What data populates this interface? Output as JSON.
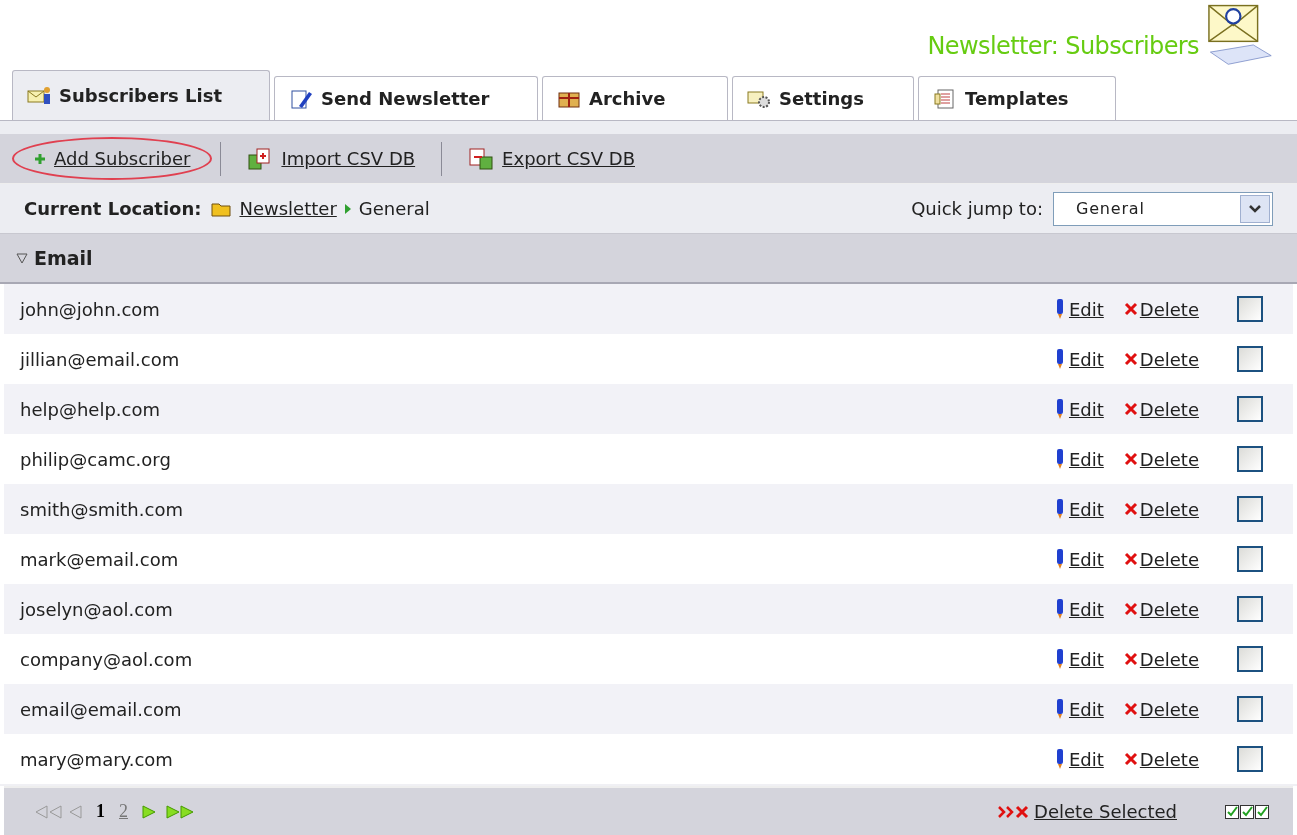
{
  "title": "Newsletter: Subscribers",
  "tabs": [
    {
      "label": "Subscribers List",
      "kind": "subscribers",
      "selected": true
    },
    {
      "label": "Send Newsletter",
      "kind": "send",
      "selected": false
    },
    {
      "label": "Archive",
      "kind": "archive",
      "selected": false
    },
    {
      "label": "Settings",
      "kind": "settings",
      "selected": false
    },
    {
      "label": "Templates",
      "kind": "templates",
      "selected": false
    }
  ],
  "toolbar": [
    {
      "label": "Add Subscriber",
      "kind": "add",
      "highlighted": true
    },
    {
      "label": "Import CSV DB",
      "kind": "import",
      "highlighted": false
    },
    {
      "label": "Export CSV DB",
      "kind": "export",
      "highlighted": false
    }
  ],
  "location": {
    "label": "Current Location:",
    "path": [
      "Newsletter",
      "General"
    ],
    "quick_jump_label": "Quick jump to:",
    "quick_jump_value": "General"
  },
  "table": {
    "column": "Email",
    "rows": [
      {
        "email": "john@john.com",
        "edit": "Edit",
        "delete": "Delete",
        "checked": false
      },
      {
        "email": "jillian@email.com",
        "edit": "Edit",
        "delete": "Delete",
        "checked": false
      },
      {
        "email": "help@help.com",
        "edit": "Edit",
        "delete": "Delete",
        "checked": false
      },
      {
        "email": "philip@camc.org",
        "edit": "Edit",
        "delete": "Delete",
        "checked": false
      },
      {
        "email": "smith@smith.com",
        "edit": "Edit",
        "delete": "Delete",
        "checked": false
      },
      {
        "email": "mark@email.com",
        "edit": "Edit",
        "delete": "Delete",
        "checked": false
      },
      {
        "email": "joselyn@aol.com",
        "edit": "Edit",
        "delete": "Delete",
        "checked": false
      },
      {
        "email": "company@aol.com",
        "edit": "Edit",
        "delete": "Delete",
        "checked": false
      },
      {
        "email": "email@email.com",
        "edit": "Edit",
        "delete": "Delete",
        "checked": false
      },
      {
        "email": "mary@mary.com",
        "edit": "Edit",
        "delete": "Delete",
        "checked": false
      }
    ]
  },
  "pager": {
    "pages": [
      {
        "label": "1",
        "selected": true
      },
      {
        "label": "2",
        "selected": false
      }
    ]
  },
  "delete_selected": "Delete Selected"
}
